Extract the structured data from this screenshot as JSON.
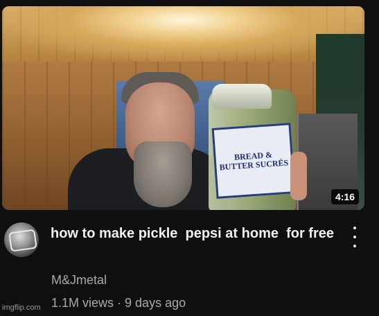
{
  "video": {
    "duration": "4:16",
    "jar_label": "BREAD & BUTTER SUCRÉS",
    "title": "how to make pickle  pepsi at home  for free",
    "channel": "M&Jmetal",
    "views": "1.1M views",
    "separator": " · ",
    "age": "9 days ago"
  },
  "watermark": "imgflip.com",
  "icons": {
    "menu": "more-vert-icon"
  },
  "colors": {
    "background": "#0f0f0f",
    "title": "#f1f1f1",
    "secondary_text": "#aaaaaa",
    "duration_badge": "#000000"
  }
}
